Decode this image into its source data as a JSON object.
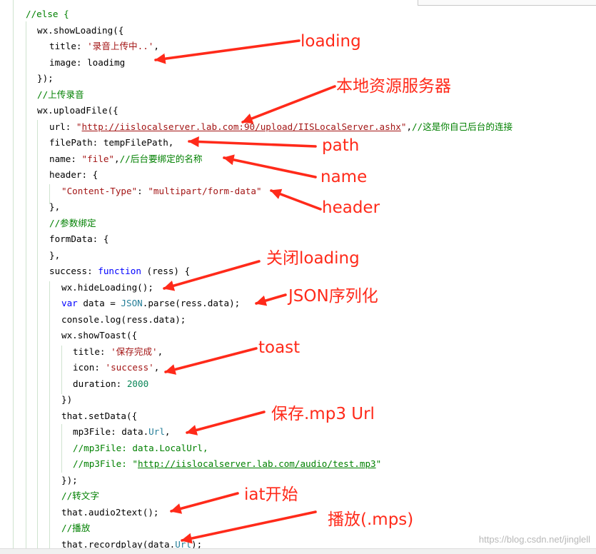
{
  "code_lines": [
    [
      {
        "t": "//else {",
        "c": "cmt"
      }
    ],
    [
      {
        "t": "wx.showLoading({",
        "c": "plain"
      }
    ],
    [
      {
        "t": "title: ",
        "c": "plain"
      },
      {
        "t": "'录音上传中..'",
        "c": "str"
      },
      {
        "t": ",",
        "c": "plain"
      }
    ],
    [
      {
        "t": "image: loadimg",
        "c": "plain"
      }
    ],
    [
      {
        "t": "});",
        "c": "plain"
      }
    ],
    [
      {
        "t": "//上传录音",
        "c": "cmt"
      }
    ],
    [
      {
        "t": "wx.uploadFile({",
        "c": "plain"
      }
    ],
    [
      {
        "t": "url: ",
        "c": "plain"
      },
      {
        "t": "\"",
        "c": "str"
      },
      {
        "t": "http://iislocalserver.lab.com:90/upload/IISLocalServer.ashx",
        "c": "link"
      },
      {
        "t": "\"",
        "c": "str"
      },
      {
        "t": ",",
        "c": "plain"
      },
      {
        "t": "//这是你自己后台的连接",
        "c": "cmt"
      }
    ],
    [
      {
        "t": "filePath: tempFilePath,",
        "c": "plain"
      }
    ],
    [
      {
        "t": "name: ",
        "c": "plain"
      },
      {
        "t": "\"file\"",
        "c": "str"
      },
      {
        "t": ",",
        "c": "plain"
      },
      {
        "t": "//后台要绑定的名称",
        "c": "cmt"
      }
    ],
    [
      {
        "t": "header: {",
        "c": "plain"
      }
    ],
    [
      {
        "t": "\"Content-Type\"",
        "c": "str"
      },
      {
        "t": ": ",
        "c": "plain"
      },
      {
        "t": "\"multipart/form-data\"",
        "c": "str"
      }
    ],
    [
      {
        "t": "},",
        "c": "plain"
      }
    ],
    [
      {
        "t": "//参数绑定",
        "c": "cmt"
      }
    ],
    [
      {
        "t": "formData: {",
        "c": "plain"
      }
    ],
    [
      {
        "t": "},",
        "c": "plain"
      }
    ],
    [
      {
        "t": "success: ",
        "c": "plain"
      },
      {
        "t": "function",
        "c": "kw"
      },
      {
        "t": " (ress) {",
        "c": "plain"
      }
    ],
    [
      {
        "t": "wx.hideLoading();",
        "c": "plain"
      }
    ],
    [
      {
        "t": "var",
        "c": "kw"
      },
      {
        "t": " data = ",
        "c": "plain"
      },
      {
        "t": "JSON",
        "c": "prop"
      },
      {
        "t": ".parse(ress.data);",
        "c": "plain"
      }
    ],
    [
      {
        "t": "console.log(ress.data);",
        "c": "plain"
      }
    ],
    [
      {
        "t": "wx.showToast({",
        "c": "plain"
      }
    ],
    [
      {
        "t": "title: ",
        "c": "plain"
      },
      {
        "t": "'保存完成'",
        "c": "str"
      },
      {
        "t": ",",
        "c": "plain"
      }
    ],
    [
      {
        "t": "icon: ",
        "c": "plain"
      },
      {
        "t": "'success'",
        "c": "str"
      },
      {
        "t": ",",
        "c": "plain"
      }
    ],
    [
      {
        "t": "duration: ",
        "c": "plain"
      },
      {
        "t": "2000",
        "c": "num"
      }
    ],
    [
      {
        "t": "})",
        "c": "plain"
      }
    ],
    [
      {
        "t": "that.setData({",
        "c": "plain"
      }
    ],
    [
      {
        "t": "mp3File: data.",
        "c": "plain"
      },
      {
        "t": "Url",
        "c": "prop"
      },
      {
        "t": ",",
        "c": "plain"
      }
    ],
    [
      {
        "t": "//mp3File: data.LocalUrl,",
        "c": "cmt"
      }
    ],
    [
      {
        "t": "//mp3File: \"",
        "c": "cmt"
      },
      {
        "t": "http://iislocalserver.lab.com/audio/test.mp3",
        "c": "cmt-link"
      },
      {
        "t": "\"",
        "c": "cmt"
      }
    ],
    [
      {
        "t": "});",
        "c": "plain"
      }
    ],
    [
      {
        "t": "//转文字",
        "c": "cmt"
      }
    ],
    [
      {
        "t": "that.audio2text();",
        "c": "plain"
      }
    ],
    [
      {
        "t": "//播放",
        "c": "cmt"
      }
    ],
    [
      {
        "t": "that.recordplay(data.",
        "c": "plain"
      },
      {
        "t": "Url",
        "c": "prop"
      },
      {
        "t": ");",
        "c": "plain"
      }
    ]
  ],
  "annotations": [
    {
      "label": "loading"
    },
    {
      "label": "本地资源服务器"
    },
    {
      "label": "path"
    },
    {
      "label": "name"
    },
    {
      "label": "header"
    },
    {
      "label": "关闭loading"
    },
    {
      "label": "JSON序列化"
    },
    {
      "label": "toast"
    },
    {
      "label": "保存.mp3 Url"
    },
    {
      "label": "iat开始"
    },
    {
      "label": "播放(.mps)"
    }
  ],
  "watermark": "https://blog.csdn.net/jinglell",
  "colors": {
    "annotation": "#ff2a1a",
    "comment": "#008000",
    "string": "#a31515",
    "keyword": "#0000ff",
    "number": "#098658",
    "property": "#267f99"
  }
}
